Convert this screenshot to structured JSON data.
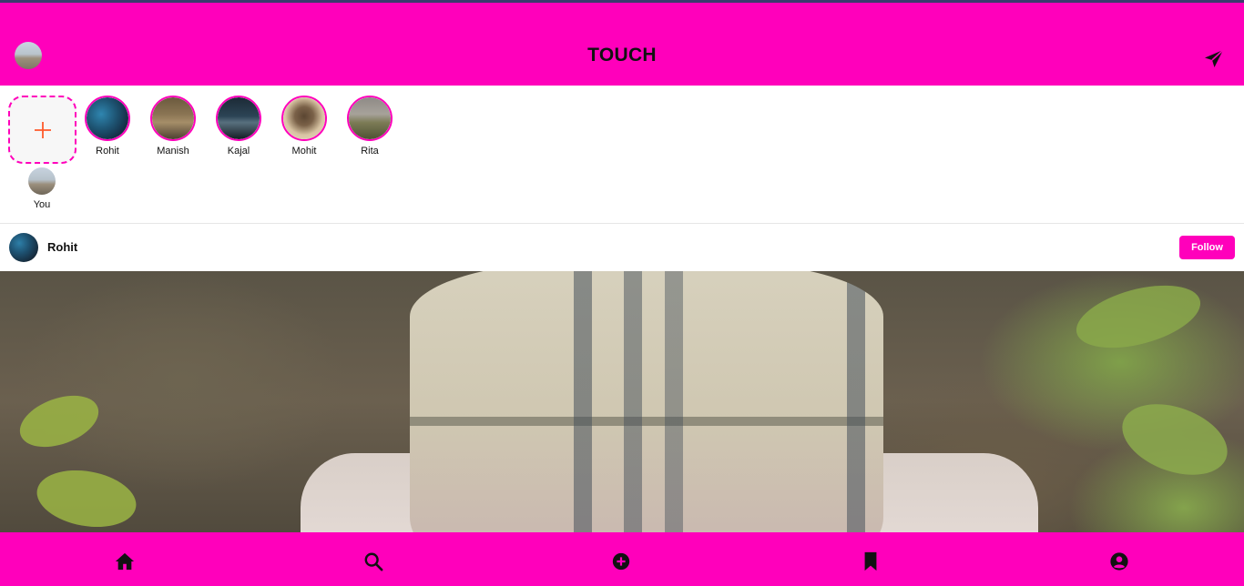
{
  "app": {
    "title": "TOUCH",
    "colors": {
      "brand": "#ff00bb",
      "accent_plus": "#ff5a2b",
      "text": "#111111"
    }
  },
  "header": {
    "left_icon": "profile-avatar",
    "right_icon": "send-icon"
  },
  "stories": {
    "add_icon": "plus-icon",
    "you_label": "You",
    "items": [
      {
        "label": "Rohit"
      },
      {
        "label": "Manish"
      },
      {
        "label": "Kajal"
      },
      {
        "label": "Mohit"
      },
      {
        "label": "Rita"
      }
    ]
  },
  "post": {
    "author": "Rohit",
    "follow_label": "Follow"
  },
  "bottom_nav": {
    "items": [
      {
        "icon": "home-icon"
      },
      {
        "icon": "search-icon"
      },
      {
        "icon": "add-circle-icon"
      },
      {
        "icon": "bookmark-icon"
      },
      {
        "icon": "profile-icon"
      }
    ]
  }
}
